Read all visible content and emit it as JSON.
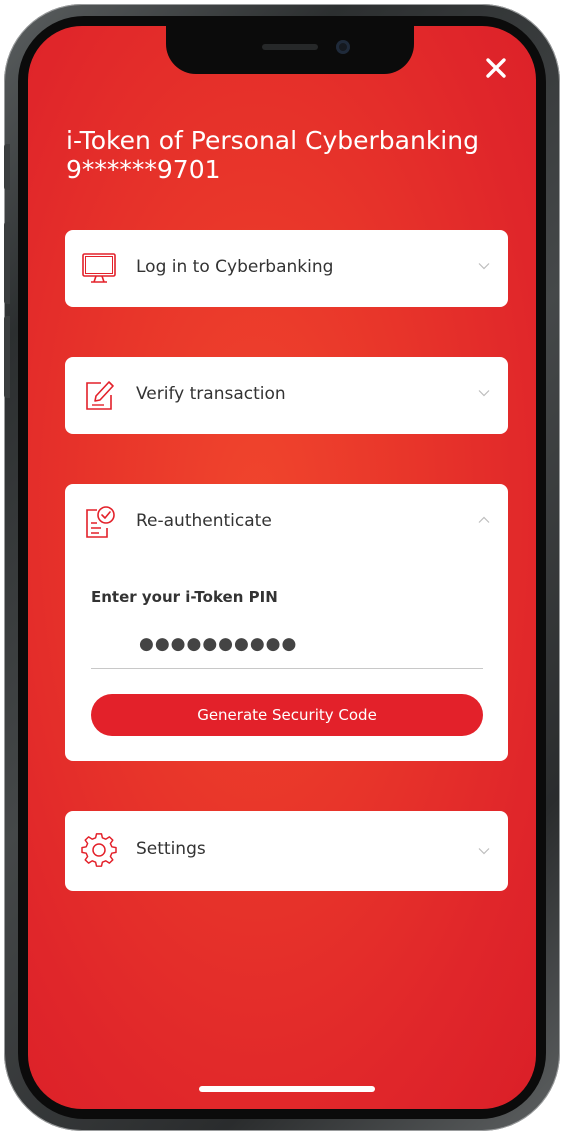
{
  "header": {
    "title_line1": "i-Token of Personal Cyberbanking",
    "title_line2": "9******9701"
  },
  "close_icon": "close-icon",
  "sections": {
    "login": {
      "label": "Log in to Cyberbanking",
      "icon": "monitor-icon",
      "expanded": false
    },
    "verify": {
      "label": "Verify transaction",
      "icon": "edit-document-icon",
      "expanded": false
    },
    "reauth": {
      "label": "Re-authenticate",
      "icon": "document-check-icon",
      "expanded": true,
      "pin_label": "Enter your i-Token PIN",
      "pin_value": "●●●●●●●●●●",
      "button_label": "Generate Security Code"
    },
    "settings": {
      "label": "Settings",
      "icon": "gear-icon",
      "expanded": false
    }
  },
  "colors": {
    "brand_red": "#e3212a",
    "background_red": "#e8352a",
    "card": "#ffffff",
    "text": "#333333"
  }
}
